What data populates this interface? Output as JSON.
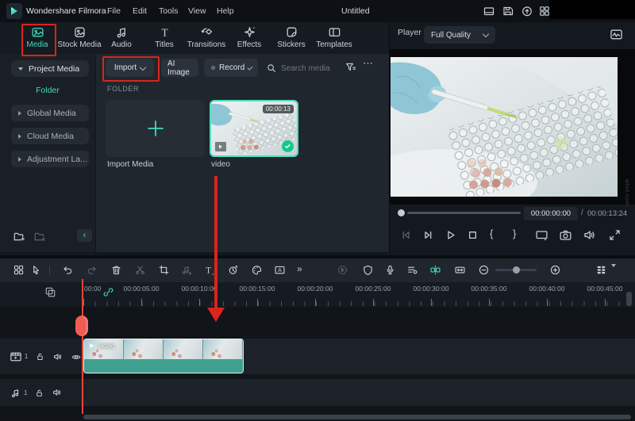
{
  "topbar": {
    "app_name": "Wondershare Filmora",
    "menu": [
      "File",
      "Edit",
      "Tools",
      "View",
      "Help"
    ],
    "project_title": "Untitled"
  },
  "tabs": [
    {
      "label": "Media",
      "active": true
    },
    {
      "label": "Stock Media"
    },
    {
      "label": "Audio"
    },
    {
      "label": "Titles"
    },
    {
      "label": "Transitions"
    },
    {
      "label": "Effects"
    },
    {
      "label": "Stickers"
    },
    {
      "label": "Templates"
    }
  ],
  "sidebar": {
    "project_media": "Project Media",
    "folder": "Folder",
    "global_media": "Global Media",
    "cloud_media": "Cloud Media",
    "adjustment": "Adjustment La..."
  },
  "media_panel": {
    "import": "Import",
    "ai_image": "AI Image",
    "record": "Record",
    "search_placeholder": "Search media",
    "folder_header": "FOLDER",
    "import_tile": "Import Media",
    "clip_name": "video",
    "clip_duration": "00:00:13"
  },
  "player": {
    "title": "Player",
    "quality": "Full Quality",
    "current_time": "00:00:00:00",
    "separator": "/",
    "total_time": "00:00:13:24",
    "watermark": "wfxd.com"
  },
  "timeline": {
    "ruler": [
      "00:00",
      "00:00:05:00",
      "00:00:10:00",
      "00:00:15:00",
      "00:00:20:00",
      "00:00:25:00",
      "00:00:30:00",
      "00:00:35:00",
      "00:00:40:00",
      "00:00:45:00"
    ],
    "video_track_number": "1",
    "audio_track_number": "1",
    "clip_label": "video"
  },
  "icons": {
    "more_horizontal": "⋯",
    "more_chevrons": "»",
    "collapse_left": "‹",
    "mark_in": "{",
    "mark_out": "}"
  },
  "colors": {
    "accent": "#45d9c0",
    "annotation_red": "#d9251d",
    "clip_band": "#3fa08f"
  }
}
